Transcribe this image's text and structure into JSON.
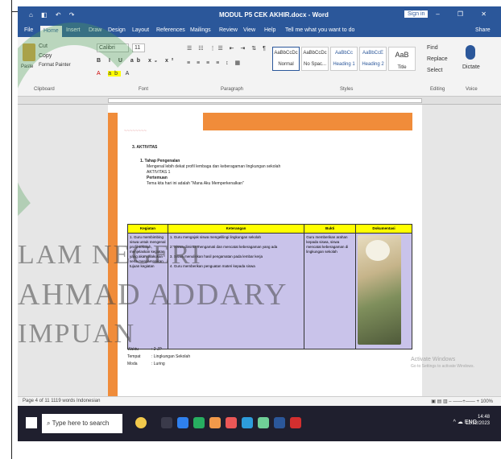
{
  "window": {
    "quick_access": "⌂ ◧ ↶ ↷",
    "title": "MODUL P5 CEK AKHIR.docx - Word",
    "signin": "Sign in",
    "controls": "▭ – ❐ ✕"
  },
  "ribbon_tabs": [
    "File",
    "Home",
    "Insert",
    "Draw",
    "Design",
    "Layout",
    "References",
    "Mailings",
    "Review",
    "View",
    "Help",
    "Tell me what you want to do",
    "Share"
  ],
  "ribbon": {
    "clipboard": {
      "paste": "Paste",
      "cut": "Cut",
      "copy": "Copy",
      "format_painter": "Format Painter",
      "label": "Clipboard"
    },
    "font": {
      "name": "Calibri",
      "size": "11",
      "label": "Font"
    },
    "paragraph": {
      "label": "Paragraph"
    },
    "styles": {
      "label": "Styles",
      "items": [
        {
          "preview": "AaBbCcDc",
          "name": "Normal"
        },
        {
          "preview": "AaBbCcDc",
          "name": "No Spac..."
        },
        {
          "preview": "AaBbCc",
          "name": "Heading 1"
        },
        {
          "preview": "AaBbCcE",
          "name": "Heading 2"
        },
        {
          "preview": "AaB",
          "name": "Title"
        }
      ]
    },
    "editing": {
      "find": "Find",
      "replace": "Replace",
      "select": "Select",
      "label": "Editing"
    },
    "voice": {
      "dictate": "Dictate",
      "label": "Voice"
    }
  },
  "document": {
    "section": "3. AKTIVITAS",
    "item_title": "1. Tahap Pengenalan",
    "item_lines": [
      "Mengenal lebih dekat profil lembaga dan keberagaman lingkungan sekolah",
      "AKTIVITAS 1",
      "Pertemuan",
      "Tema kita hari ini adalah \"Mana Aku Memperkenalkan\""
    ],
    "table": {
      "headers": [
        "Kegiatan",
        "Keterangan",
        "Bukti",
        "Dokumentasi"
      ],
      "col1": "1. Guru membimbing siswa untuk mengenal profil sekolah, menjelaskan kegiatan yang akan dilakukan serta menyampaikan tujuan kegiatan",
      "col2": [
        "1. Guru mengajak siswa mengelilingi lingkungan sekolah",
        "2. Siswa diminta mengamati dan mencatat keberagaman yang ada",
        "3. Siswa menuliskan hasil pengamatan pada lembar kerja",
        "4. Guru memberikan penguatan materi kepada siswa"
      ],
      "col3": "Guru memberikan arahan kepada siswa, siswa mencatat keberagaman di lingkungan sekolah"
    },
    "meta": [
      {
        "k": "Waktu",
        "v": "2 JP"
      },
      {
        "k": "Tempat",
        "v": "Lingkungan Sekolah"
      },
      {
        "k": "Moda",
        "v": "Luring"
      }
    ]
  },
  "watermark": {
    "line1": "LAM NEGERI",
    "line2": "AHMAD ADDARY",
    "line3": "IMPUAN"
  },
  "activate": {
    "line1": "Activate Windows",
    "line2": "Go to Settings to activate Windows."
  },
  "statusbar": {
    "left": "Page 4 of 11    1119 words    Indonesian",
    "right": "▣ ▤ ▥    –  ——+——  +  100%"
  },
  "taskbar": {
    "search_placeholder": "Type here to search",
    "tray": "^  ☁  ENG",
    "time": "14:48",
    "date": "12/12/2023"
  }
}
